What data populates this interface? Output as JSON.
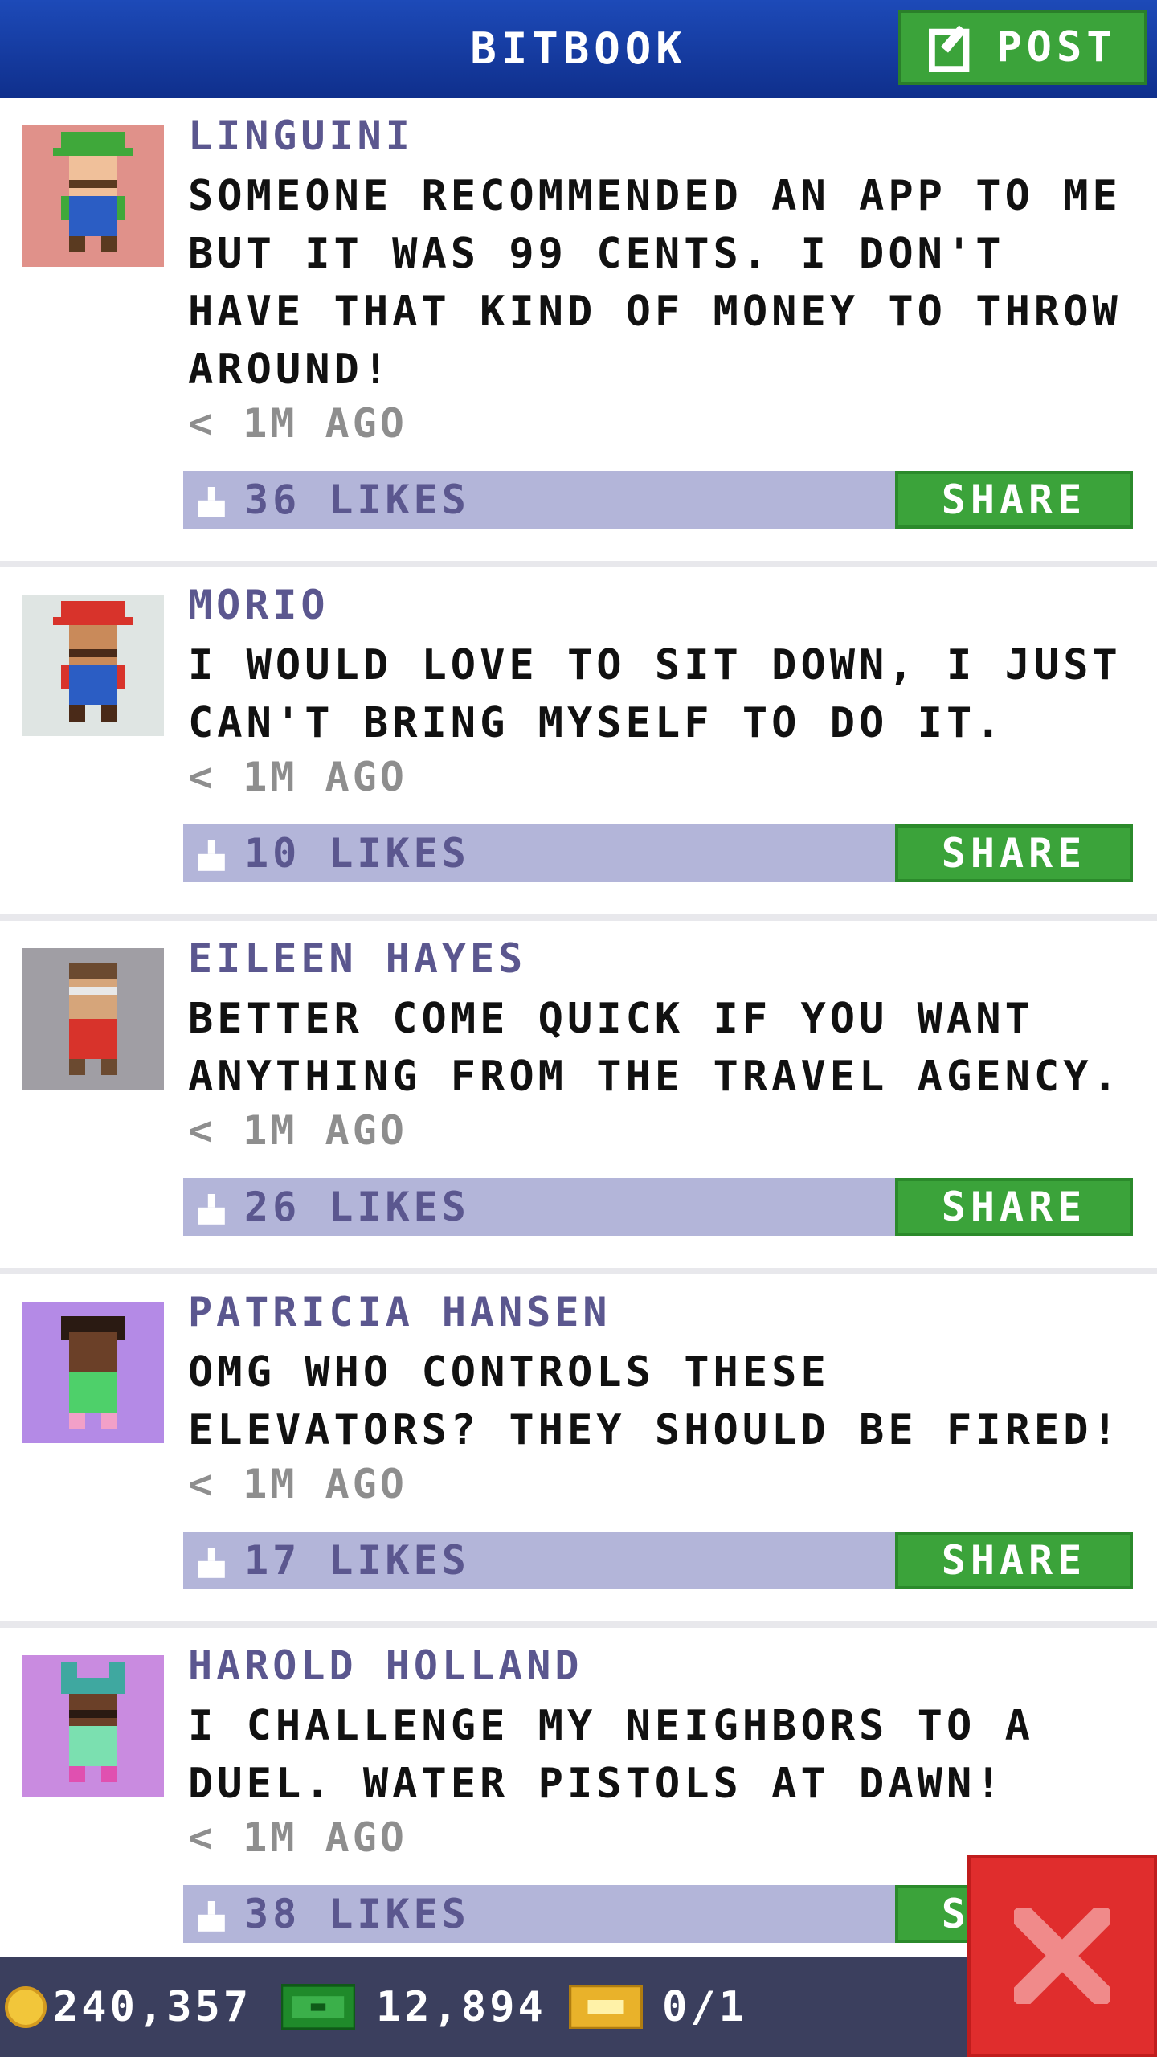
{
  "header": {
    "title": "BITBOOK",
    "post_label": "POST"
  },
  "posts": [
    {
      "author": "LINGUINI",
      "message": "SOMEONE RECOMMENDED AN APP TO ME BUT IT WAS 99 CENTS. I DON'T HAVE THAT KIND OF MONEY TO THROW AROUND!",
      "time": "< 1M AGO",
      "likes": "36 LIKES",
      "share": "SHARE"
    },
    {
      "author": "MORIO",
      "message": "I WOULD LOVE TO SIT DOWN, I JUST CAN'T BRING MYSELF TO DO IT.",
      "time": "< 1M AGO",
      "likes": "10 LIKES",
      "share": "SHARE"
    },
    {
      "author": "EILEEN HAYES",
      "message": "BETTER COME QUICK IF YOU WANT ANYTHING FROM THE TRAVEL AGENCY.",
      "time": "< 1M AGO",
      "likes": "26 LIKES",
      "share": "SHARE"
    },
    {
      "author": "PATRICIA HANSEN",
      "message": "OMG WHO CONTROLS THESE ELEVATORS? THEY SHOULD BE FIRED!",
      "time": "< 1M AGO",
      "likes": "17 LIKES",
      "share": "SHARE"
    },
    {
      "author": "HAROLD HOLLAND",
      "message": "I CHALLENGE MY NEIGHBORS TO A DUEL. WATER PISTOLS AT DAWN!",
      "time": "< 1M AGO",
      "likes": "38 LIKES",
      "share": "SHARE"
    }
  ],
  "status": {
    "coins": "240,357",
    "bux": "12,894",
    "tickets": "0/1"
  },
  "colors": {
    "header": "#1d4ab8",
    "share": "#3ba33a",
    "like_bar": "#b3b5d9",
    "close": "#e02d2d"
  },
  "icons": {
    "post": "edit-icon",
    "like": "thumbs-up-icon",
    "close": "close-icon",
    "coin": "coin-icon",
    "cash": "cash-icon",
    "ticket": "ticket-icon"
  }
}
